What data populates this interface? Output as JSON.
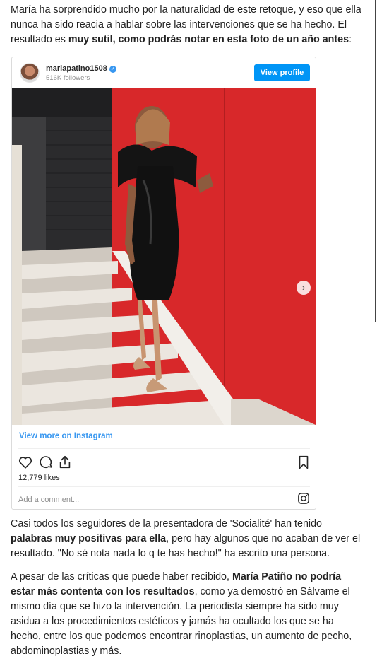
{
  "article": {
    "p1": {
      "text_a": "María ha sorprendido mucho por la naturalidad de este retoque, y eso que ella nunca ha sido reacia a hablar sobre las intervenciones que se ha hecho. El resultado es ",
      "bold_a": "muy sutil, como podrás notar en esta foto de un año antes",
      "text_b": ":"
    },
    "p2": {
      "text_a": "Casi todos los seguidores de la presentadora de 'Socialité' han tenido ",
      "bold_a": "palabras muy positivas para ella",
      "text_b": ", pero hay algunos que no acaban de ver el resultado. \"No sé nota nada lo q te has hecho!\" ha escrito una persona."
    },
    "p3": {
      "text_a": "A pesar de las críticas que puede haber recibido, ",
      "bold_a": "María Patiño no podría estar más contenta con los resultados",
      "text_b": ", como ya demostró en Sálvame el mismo día que se hizo la intervención. La periodista siempre ha sido muy asidua a los procedimientos estéticos y jamás ha ocultado los que se ha hecho, entre los que podemos encontrar rinoplastias, un aumento de pecho, abdominoplastias y más."
    }
  },
  "instagram": {
    "username": "mariapatino1508",
    "verified_mark": "✓",
    "followers": "516K followers",
    "view_profile_label": "View profile",
    "view_more_label": "View more on Instagram",
    "likes": "12,779 likes",
    "comment_placeholder": "Add a comment...",
    "next_arrow": "›",
    "carousel_dots": 4,
    "active_dot": 1,
    "accent_color": "#0095f6",
    "icons": [
      "heart-icon",
      "comment-icon",
      "share-icon",
      "bookmark-icon",
      "instagram-logo-icon",
      "chevron-right-icon"
    ]
  }
}
